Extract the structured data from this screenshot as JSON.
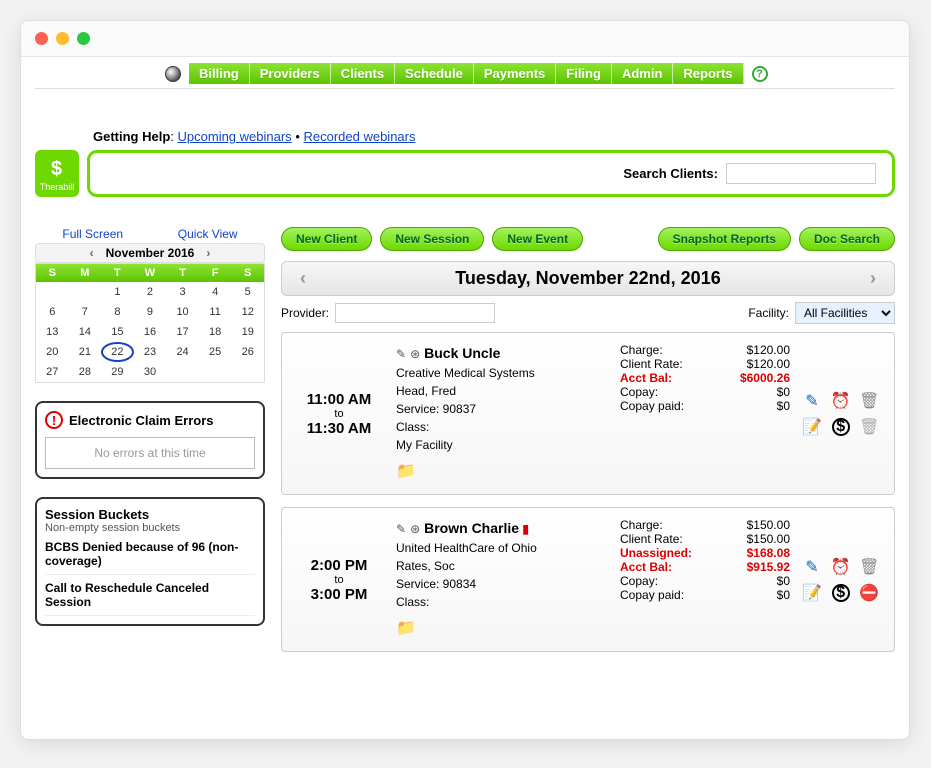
{
  "nav": {
    "items": [
      "Billing",
      "Providers",
      "Clients",
      "Schedule",
      "Payments",
      "Filing",
      "Admin",
      "Reports"
    ]
  },
  "help_line": {
    "prefix": "Getting Help",
    "link1": "Upcoming webinars",
    "sep": " • ",
    "link2": "Recorded webinars"
  },
  "logo_text": "Therabill",
  "search_label": "Search Clients:",
  "calendar": {
    "full_screen": "Full Screen",
    "quick_view": "Quick View",
    "month_label": "November 2016",
    "dow": [
      "S",
      "M",
      "T",
      "W",
      "T",
      "F",
      "S"
    ],
    "days": [
      "",
      "",
      "1",
      "2",
      "3",
      "4",
      "5",
      "6",
      "7",
      "8",
      "9",
      "10",
      "11",
      "12",
      "13",
      "14",
      "15",
      "16",
      "17",
      "18",
      "19",
      "20",
      "21",
      "22",
      "23",
      "24",
      "25",
      "26",
      "27",
      "28",
      "29",
      "30",
      "",
      "",
      ""
    ],
    "selected_day": "22"
  },
  "errors_panel": {
    "title": "Electronic Claim Errors",
    "empty": "No errors at this time"
  },
  "buckets_panel": {
    "title": "Session Buckets",
    "subtitle": "Non-empty session buckets",
    "items": [
      "BCBS Denied because of 96 (non-coverage)",
      "Call to Reschedule Canceled Session"
    ]
  },
  "actions": {
    "new_client": "New Client",
    "new_session": "New Session",
    "new_event": "New Event",
    "snapshot": "Snapshot Reports",
    "doc_search": "Doc Search"
  },
  "date_header": "Tuesday, November 22nd, 2016",
  "provider_label": "Provider:",
  "facility_label": "Facility:",
  "facility_value": "All Facilities",
  "sessions": [
    {
      "time_start": "11:00 AM",
      "time_to": "to",
      "time_end": "11:30 AM",
      "name": "Buck Uncle",
      "lines": [
        "Creative Medical Systems",
        "Head, Fred",
        "Service: 90837",
        "Class:",
        "My Facility"
      ],
      "fin": [
        {
          "label": "Charge:",
          "value": "$120.00",
          "red": false
        },
        {
          "label": "Client Rate:",
          "value": "$120.00",
          "red": false
        },
        {
          "label": "Acct Bal:",
          "value": "$6000.26",
          "red": true
        },
        {
          "label": "Copay:",
          "value": "$0",
          "red": false
        },
        {
          "label": "Copay paid:",
          "value": "$0",
          "red": false
        }
      ],
      "alert": false
    },
    {
      "time_start": "2:00 PM",
      "time_to": "to",
      "time_end": "3:00 PM",
      "name": "Brown Charlie",
      "lines": [
        "United HealthCare of Ohio",
        "Rates, Soc",
        "Service: 90834",
        "Class:"
      ],
      "fin": [
        {
          "label": "Charge:",
          "value": "$150.00",
          "red": false
        },
        {
          "label": "Client Rate:",
          "value": "$150.00",
          "red": false
        },
        {
          "label": "Unassigned:",
          "value": "$168.08",
          "red": true
        },
        {
          "label": "Acct Bal:",
          "value": "$915.92",
          "red": true
        },
        {
          "label": "Copay:",
          "value": "$0",
          "red": false
        },
        {
          "label": "Copay paid:",
          "value": "$0",
          "red": false
        }
      ],
      "alert": true
    }
  ]
}
